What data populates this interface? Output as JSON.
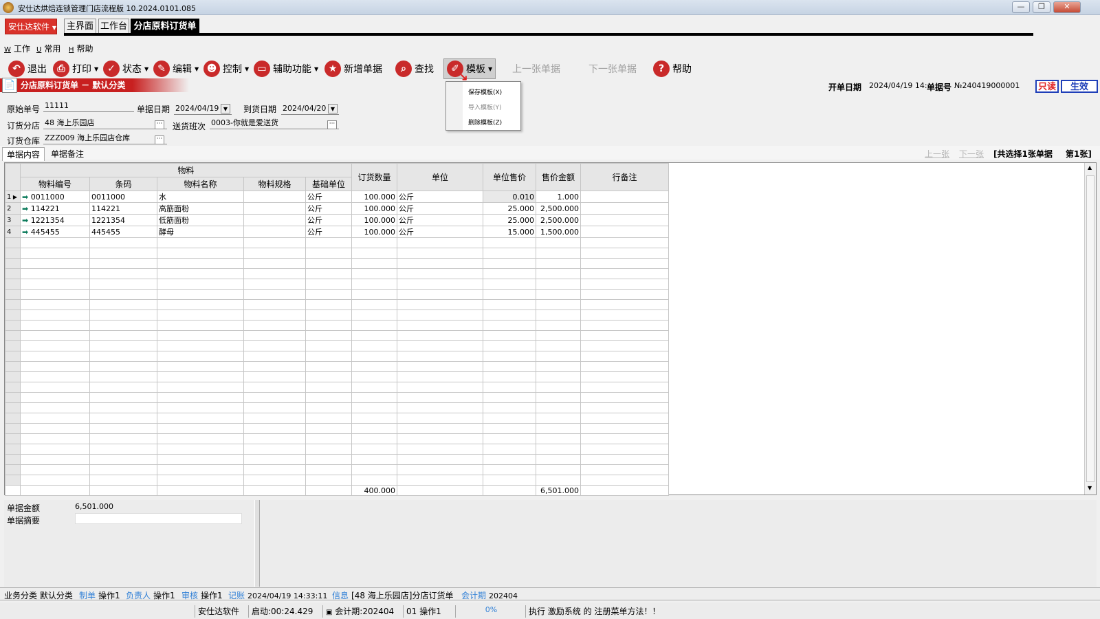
{
  "window": {
    "title": "安仕达烘焙连锁管理门店流程版  10.2024.0101.085",
    "min": "—",
    "max": "❐",
    "close": "✕"
  },
  "brand_button": "安仕达软件",
  "tabs": [
    "主界面",
    "工作台",
    "分店原料订货单"
  ],
  "menu": [
    {
      "key": "W",
      "label": "工作"
    },
    {
      "key": "U",
      "label": "常用"
    },
    {
      "key": "H",
      "label": "帮助"
    }
  ],
  "toolbar": {
    "exit": "退出",
    "print": "打印",
    "status": "状态",
    "edit": "编辑",
    "control": "控制",
    "aux": "辅助功能",
    "new": "新增单据",
    "find": "查找",
    "template": "模板",
    "prev": "上一张单据",
    "next": "下一张单据",
    "help": "帮助"
  },
  "template_menu": {
    "save": "保存模板(X)",
    "import": "导入模板(Y)",
    "delete": "删除模板(Z)"
  },
  "doc": {
    "title": "分店原料订货单 － 默认分类",
    "open_date_label": "开单日期",
    "open_date": "2024/04/19 14:",
    "doc_no_label": "单据号",
    "doc_no": "№240419000001",
    "readonly": "只读",
    "effective": "生效"
  },
  "form": {
    "orig_no_label": "原始单号",
    "orig_no": "11111",
    "doc_date_label": "单据日期",
    "doc_date": "2024/04/19",
    "arrive_date_label": "到货日期",
    "arrive_date": "2024/04/20",
    "branch_label": "订货分店",
    "branch": "48  海上乐园店",
    "shift_label": "送货班次",
    "shift": "0003-你就是爱送货",
    "warehouse_label": "订货仓库",
    "warehouse": "ZZZ009  海上乐园店仓库"
  },
  "subtabs": [
    "单据内容",
    "单据备注"
  ],
  "nav": {
    "prev": "上一张",
    "next": "下一张",
    "summary": "[共选择1张单据",
    "page": "第1张]"
  },
  "grid": {
    "group_header": "物料",
    "headers": [
      "物料编号",
      "条码",
      "物料名称",
      "物料规格",
      "基础单位",
      "订货数量",
      "单位",
      "单位售价",
      "售价金额",
      "行备注"
    ],
    "rows": [
      {
        "n": "1",
        "code": "0011000",
        "barcode": "0011000",
        "name": "水",
        "spec": "",
        "unit": "公斤",
        "qty": "100.000",
        "u2": "公斤",
        "price": "0.010",
        "amount": "1.000",
        "note": ""
      },
      {
        "n": "2",
        "code": "114221",
        "barcode": "114221",
        "name": "高筋面粉",
        "spec": "",
        "unit": "公斤",
        "qty": "100.000",
        "u2": "公斤",
        "price": "25.000",
        "amount": "2,500.000",
        "note": ""
      },
      {
        "n": "3",
        "code": "1221354",
        "barcode": "1221354",
        "name": "低筋面粉",
        "spec": "",
        "unit": "公斤",
        "qty": "100.000",
        "u2": "公斤",
        "price": "25.000",
        "amount": "2,500.000",
        "note": ""
      },
      {
        "n": "4",
        "code": "445455",
        "barcode": "445455",
        "name": "酵母",
        "spec": "",
        "unit": "公斤",
        "qty": "100.000",
        "u2": "公斤",
        "price": "15.000",
        "amount": "1,500.000",
        "note": ""
      }
    ],
    "total_qty": "400.000",
    "total_amount": "6,501.000"
  },
  "bottom": {
    "amount_label": "单据金额",
    "amount": "6,501.000",
    "summary_label": "单据摘要",
    "summary": ""
  },
  "status1": {
    "category_label": "业务分类",
    "category": "默认分类",
    "maker_label": "制单",
    "maker": "操作1",
    "owner_label": "负责人",
    "owner": "操作1",
    "audit_label": "审核",
    "audit": "操作1",
    "post_label": "记账",
    "post": "2024/04/19 14:33:11",
    "info_label": "信息",
    "info": "[48 海上乐园店]分店订货单",
    "period_label": "会计期",
    "period": "202404"
  },
  "status2": {
    "company": "安仕达软件",
    "uptime": "启动:00:24.429",
    "period": "会计期:202404",
    "user": "01 操作1",
    "percent": "0%",
    "message": "执行 激励系统 的 注册菜单方法！！"
  }
}
